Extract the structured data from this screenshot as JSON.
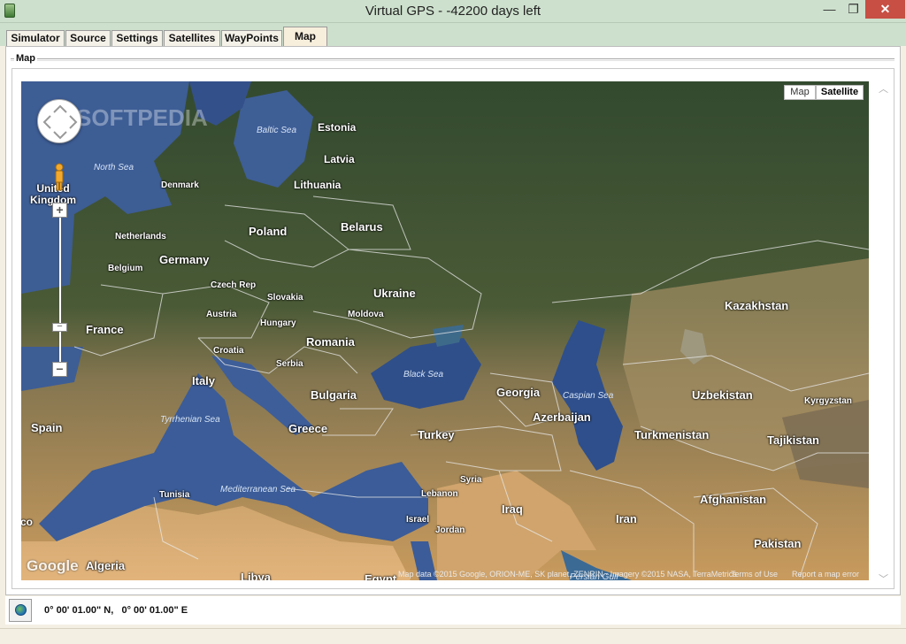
{
  "window": {
    "title": "Virtual GPS - -42200 days left",
    "icon": "app-icon",
    "controls": {
      "minimize": "—",
      "maximize": "❐",
      "close": "✕"
    }
  },
  "tabs": [
    {
      "label": "Simulator"
    },
    {
      "label": "Source"
    },
    {
      "label": "Settings"
    },
    {
      "label": "Satellites"
    },
    {
      "label": "WayPoints"
    },
    {
      "label": "Map",
      "active": true
    }
  ],
  "panel": {
    "group_label": "Map"
  },
  "map": {
    "type_buttons": {
      "map": "Map",
      "satellite": "Satellite",
      "selected": "Satellite"
    },
    "watermark": "SOFTPEDIA",
    "google_logo": "Google",
    "attribution": "Map data ©2015 Google, ORION-ME, SK planet, ZENRIN · Imagery ©2015 NASA, TerraMetrics",
    "terms": "Terms of Use",
    "report": "Report a map error",
    "controls": {
      "zoom_in": "+",
      "zoom_out": "−",
      "slider": "−"
    },
    "country_labels": [
      "Estonia",
      "Latvia",
      "Lithuania",
      "Denmark",
      "United Kingdom",
      "Netherlands",
      "Poland",
      "Belarus",
      "Germany",
      "Belgium",
      "Czech Rep",
      "Slovakia",
      "Ukraine",
      "Austria",
      "Hungary",
      "Moldova",
      "France",
      "Romania",
      "Croatia",
      "Serbia",
      "Italy",
      "Bulgaria",
      "Georgia",
      "Kazakhstan",
      "Uzbekistan",
      "Kyrgyzstan",
      "Azerbaijan",
      "Turkmenistan",
      "Tajikistan",
      "Spain",
      "Greece",
      "Turkey",
      "Syria",
      "Tunisia",
      "Lebanon",
      "Iraq",
      "Israel",
      "Jordan",
      "Iran",
      "Afghanistan",
      "Pakistan",
      "Algeria",
      "Libya",
      "Egypt",
      "Morocco"
    ],
    "sea_labels": [
      "Baltic Sea",
      "North Sea",
      "Black Sea",
      "Caspian Sea",
      "Tyrrhenian Sea",
      "Mediterranean Sea",
      "Persian Gulf"
    ]
  },
  "status": {
    "coordinates": "0° 00' 01.00\" N,   0° 00' 01.00\" E",
    "globe_icon": "globe-icon"
  }
}
